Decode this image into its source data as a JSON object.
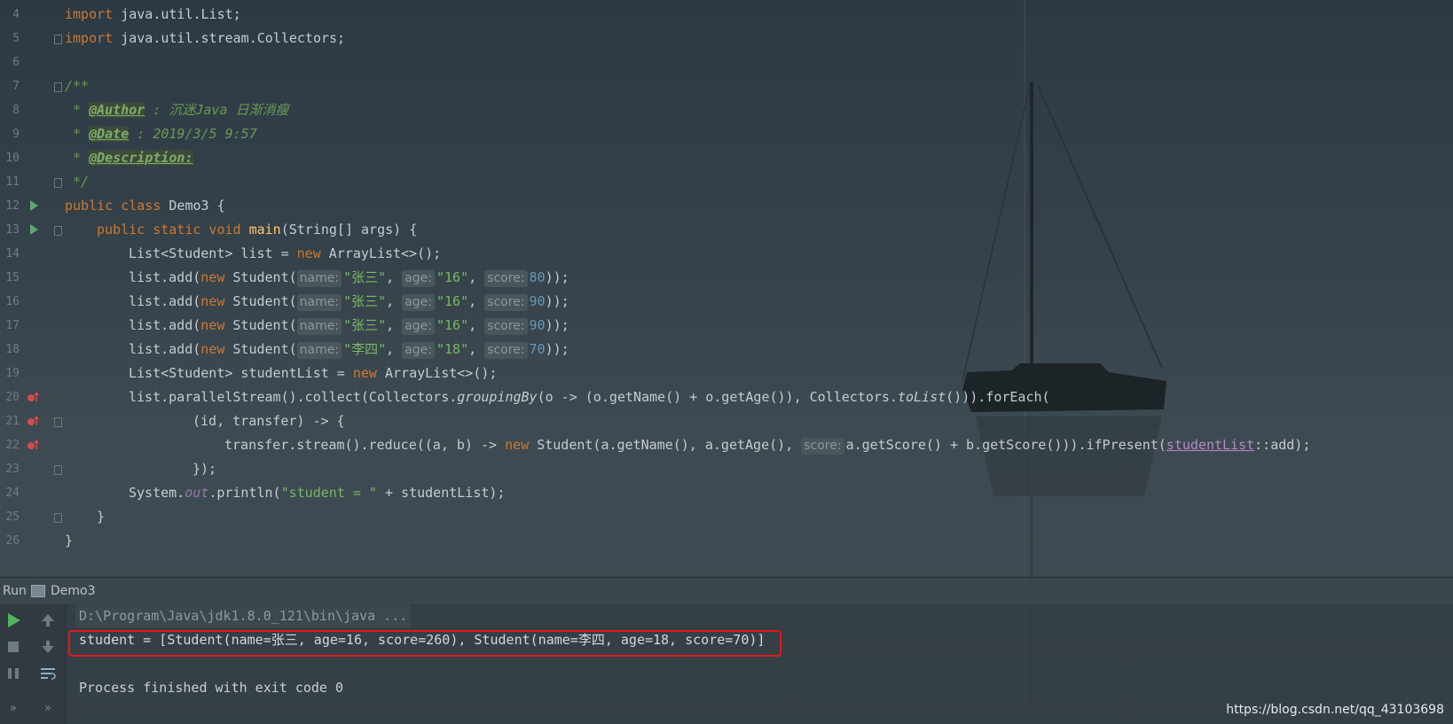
{
  "editor": {
    "lines": [
      {
        "n": "4"
      },
      {
        "n": "5"
      },
      {
        "n": "6"
      },
      {
        "n": "7"
      },
      {
        "n": "8"
      },
      {
        "n": "9"
      },
      {
        "n": "10"
      },
      {
        "n": "11"
      },
      {
        "n": "12"
      },
      {
        "n": "13"
      },
      {
        "n": "14"
      },
      {
        "n": "15"
      },
      {
        "n": "16"
      },
      {
        "n": "17"
      },
      {
        "n": "18"
      },
      {
        "n": "19"
      },
      {
        "n": "20"
      },
      {
        "n": "21"
      },
      {
        "n": "22"
      },
      {
        "n": "23"
      },
      {
        "n": "24"
      },
      {
        "n": "25"
      },
      {
        "n": "26"
      }
    ],
    "tokens": {
      "import_kw": "import",
      "l4_pkg": " java.util.List;",
      "l5_pkg": " java.util.stream.Collectors;",
      "l7": "/**",
      "l8_star": " * ",
      "l8_tag": "@Author",
      "l8_rest": " : 沉迷Java 日渐消瘦",
      "l9_star": " * ",
      "l9_tag": "@Date",
      "l9_rest": " : 2019/3/5 9:57",
      "l10_star": " * ",
      "l10_tag": "@Description:",
      "l11": " */",
      "public_kw": "public",
      "class_kw": " class",
      "l12_rest": " Demo3 {",
      "static_kw": " static",
      "void_kw": " void",
      "main_fn": " main",
      "l13_rest": "(String[] args) {",
      "l14_a": "List<Student> list = ",
      "new_kw": "new",
      "l14_b": " ArrayList<>();",
      "add_a": "list.add(",
      "student_ctor": " Student(",
      "hint_name": "name:",
      "hint_age": "age:",
      "hint_score": "score:",
      "comma": ", ",
      "close": "));",
      "s_zhangsan": "\"张三\"",
      "s_lisi": "\"李四\"",
      "s_16": "\"16\"",
      "s_18": "\"18\"",
      "n_80": "80",
      "n_90": "90",
      "n_70": "70",
      "l19_a": "List<Student> studentList = ",
      "l20_a": "list.parallelStream().collect(Collectors.",
      "l20_grouping": "groupingBy",
      "l20_b": "(o -> (o.getName() + o.getAge()), Collectors.",
      "l20_tolist": "toList",
      "l20_c": "())).forEach(",
      "l21": "(id, transfer) -> {",
      "l22_a": "transfer.stream().reduce((a, b) -> ",
      "l22_b": " Student(a.getName(), a.getAge(), ",
      "l22_c": "a.getScore() + b.getScore())).ifPresent(",
      "l22_link": "studentList",
      "l22_d": "::add);",
      "l23": "});",
      "l24_a": "System.",
      "l24_out": "out",
      "l24_b": ".println(",
      "l24_str": "\"student = \"",
      "l24_c": " + studentList);",
      "l25": "}",
      "l26": "}"
    }
  },
  "run": {
    "label": "Run",
    "config": "Demo3"
  },
  "console": {
    "command": "D:\\Program\\Java\\jdk1.8.0_121\\bin\\java ...",
    "output": "student = [Student(name=张三, age=16, score=260), Student(name=李四, age=18, score=70)]",
    "exit": "Process finished with exit code 0"
  },
  "watermark": "https://blog.csdn.net/qq_43103698",
  "colors": {
    "keyword": "#cc7832",
    "string": "#77b767",
    "number": "#6897bb",
    "highlight_box": "#e0181b"
  }
}
